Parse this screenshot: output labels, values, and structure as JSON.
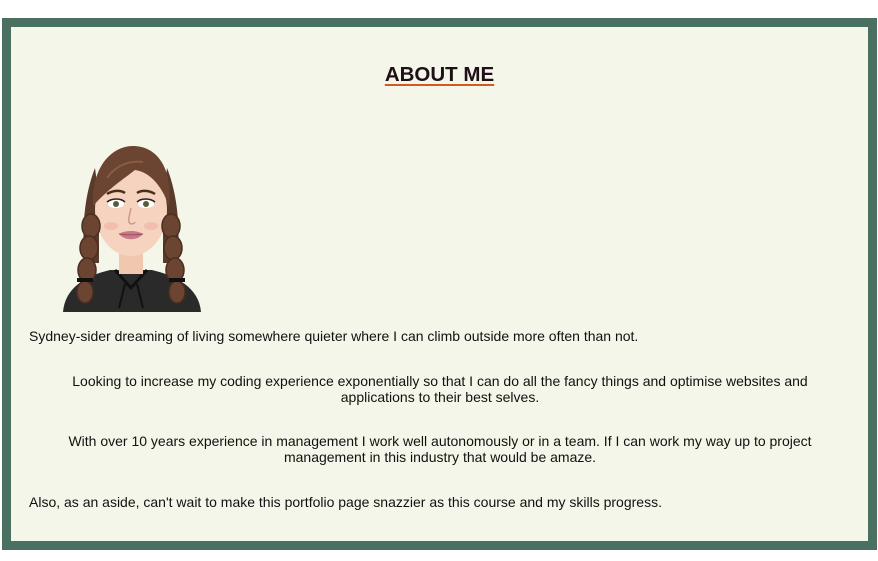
{
  "page": {
    "heading": "ABOUT ME",
    "paragraphs": [
      "Sydney-sider dreaming of living somewhere quieter where I can climb outside more often than not.",
      "Looking to increase my coding experience exponentially so that I can do all the fancy things and optimise websites and applications to their best selves.",
      "With over 10 years experience in management I work well autonomously or in a team. If I can work my way up to project management in this industry that would be amaze.",
      "Also, as an aside, can't wait to make this portfolio page snazzier as this course and my skills progress."
    ]
  },
  "colors": {
    "frame_border": "#4a7062",
    "frame_background": "#f4f6ea",
    "heading_text": "#1f0f16",
    "heading_underline": "#d05a1f"
  },
  "avatar": {
    "icon": "avatar-illustration"
  }
}
